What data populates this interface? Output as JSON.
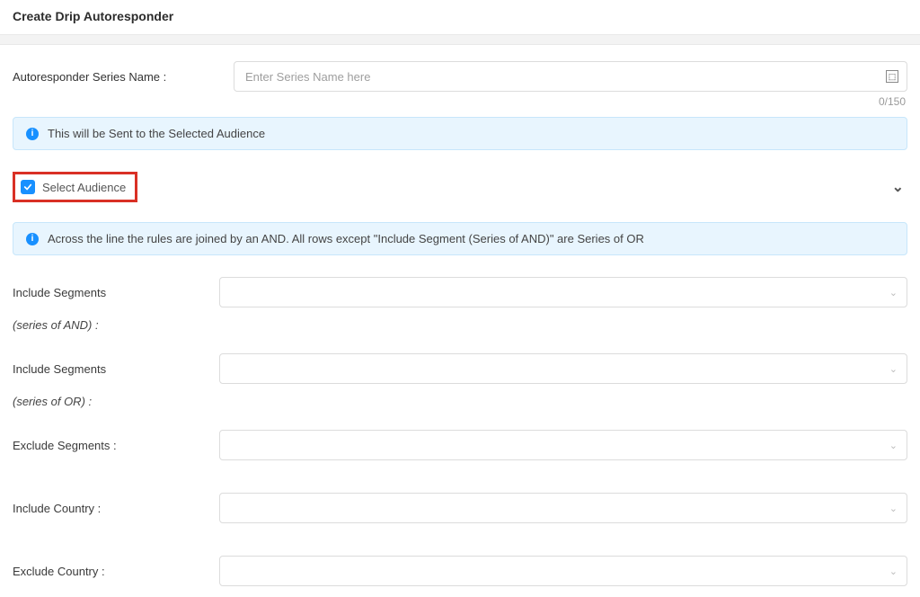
{
  "header": {
    "title": "Create Drip Autoresponder"
  },
  "seriesName": {
    "label": "Autoresponder Series Name :",
    "placeholder": "Enter Series Name here",
    "value": "",
    "count": "0/150"
  },
  "banner1": {
    "text": "This will be Sent to the Selected Audience"
  },
  "selectAudience": {
    "label": "Select Audience"
  },
  "banner2": {
    "text": "Across the line the rules are joined by an AND. All rows except \"Include Segment (Series of AND)\" are Series of OR"
  },
  "fields": {
    "includeSegAnd": {
      "label": "Include Segments",
      "sub": "(series of AND) :"
    },
    "includeSegOr": {
      "label": "Include Segments",
      "sub": "(series of OR) :"
    },
    "excludeSeg": {
      "label": "Exclude Segments :"
    },
    "includeCountry": {
      "label": "Include Country :"
    },
    "excludeCountry": {
      "label": "Exclude Country :"
    }
  }
}
